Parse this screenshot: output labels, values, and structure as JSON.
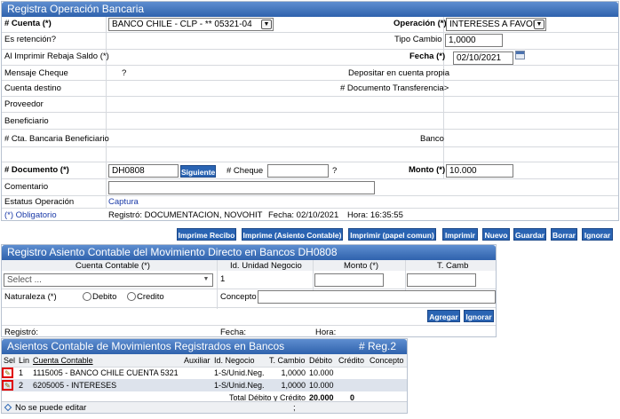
{
  "form": {
    "title": "Registra Operación Bancaria",
    "cuenta_label": "# Cuenta (*)",
    "cuenta_value": "BANCO CHILE - CLP - ** 05321-04",
    "operacion_label": "Operación (*)",
    "operacion_value": "INTERESES A FAVOR",
    "retencion_label": "Es retención?",
    "tipo_cambio_label": "Tipo Cambio",
    "tipo_cambio_value": "1,0000",
    "al_imprimir_label": "Al Imprimir Rebaja Saldo (*)",
    "fecha_label": "Fecha (*)",
    "fecha_value": "02/10/2021",
    "mensaje_cheque_label": "Mensaje Cheque",
    "mensaje_cheque_value": "?",
    "depositar_label": "Depositar en cuenta propia",
    "cuenta_destino_label": "Cuenta destino",
    "doc_transferencia_label": "# Documento Transferencia>",
    "proveedor_label": "Proveedor",
    "beneficiario_label": "Beneficiario",
    "cta_bancaria_label": "# Cta. Bancaria Beneficiario",
    "banco_label": "Banco",
    "documento_label": "# Documento (*)",
    "documento_value": "DH0808",
    "siguiente_label": "Siguiente",
    "cheque_label": "# Cheque",
    "cheque_help": "?",
    "monto_label": "Monto (*)",
    "monto_value": "10.000",
    "comentario_label": "Comentario",
    "estatus_label": "Estatus Operación",
    "estatus_value": "Captura",
    "obligatorio_label": "(*) Obligatorio",
    "registro_info": "Registró: DOCUMENTACION, NOVOHIT",
    "fecha_info": "Fecha: 02/10/2021",
    "hora_info": "Hora: 16:35:55"
  },
  "toolbar": {
    "imprime_recibo": "Imprime Recibo",
    "imprime_asiento": "Imprime (Asiento Contable)",
    "imprimir_papel": "Imprimir (papel comun)",
    "imprimir": "Imprimir",
    "nuevo": "Nuevo",
    "guardar": "Guardar",
    "borrar": "Borrar",
    "ignorar": "Ignorar"
  },
  "asiento": {
    "title": "Registro Asiento Contable del Movimiento Directo en Bancos DH0808",
    "col_cuenta": "Cuenta Contable (*)",
    "col_unidad": "Id. Unidad Negocio",
    "col_monto": "Monto (*)",
    "col_tcamb": "T. Camb",
    "select_placeholder": "Select ...",
    "unidad_value": "1",
    "naturaleza_label": "Naturaleza (*)",
    "debito_label": "Debito",
    "credito_label": "Credito",
    "concepto_label": "Concepto",
    "agregar": "Agregar",
    "ignorar": "Ignorar",
    "registro_label": "Registró:",
    "fecha_label": "Fecha:",
    "hora_label": "Hora:"
  },
  "movimientos": {
    "title": "Asientos Contable de Movimientos Registrados en Bancos",
    "reg_count": "# Reg.2",
    "headers": [
      "Sel",
      "Lin",
      "Cuenta Contable",
      "Auxiliar",
      "Id. Negocio",
      "T. Cambio",
      "Débito",
      "Crédito",
      "Concepto"
    ],
    "rows": [
      {
        "lin": "1",
        "cuenta": "1115005 - BANCO CHILE CUENTA 5321",
        "auxiliar": "",
        "negocio": "1-S/Unid.Neg.",
        "tcambio": "1,0000",
        "debito": "10.000",
        "credito": "",
        "concepto": ""
      },
      {
        "lin": "2",
        "cuenta": "6205005 - INTERESES",
        "auxiliar": "",
        "negocio": "1-S/Unid.Neg.",
        "tcambio": "1,0000",
        "debito": "10.000",
        "credito": "",
        "concepto": ""
      }
    ],
    "total_label": "Total Débito y Crédito",
    "total_debito": "20.000",
    "total_credito": "0",
    "footer_note": "No se puede editar",
    "footer_mid": ";"
  },
  "colors": {
    "header_blue": "#2f62ad",
    "button_blue": "#2a64b3",
    "highlight_red": "#e00000"
  }
}
